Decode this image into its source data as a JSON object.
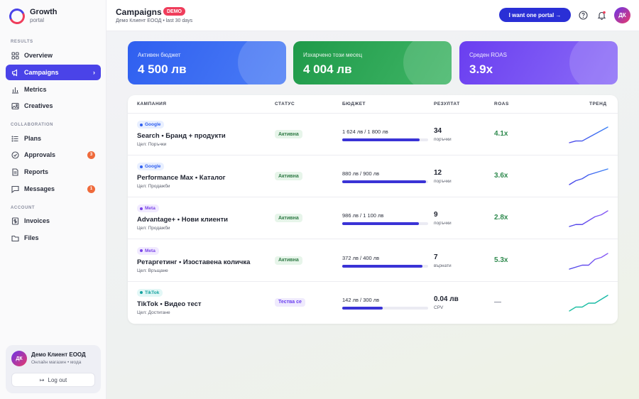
{
  "brand": {
    "title": "Growth",
    "subtitle": "portal"
  },
  "sidebar": {
    "sections": [
      {
        "label": "RESULTS"
      },
      {
        "label": "COLLABORATION"
      },
      {
        "label": "ACCOUNT"
      }
    ],
    "items": [
      {
        "label": "Overview",
        "icon": "grid-icon"
      },
      {
        "label": "Campaigns",
        "icon": "megaphone-icon",
        "active": true
      },
      {
        "label": "Metrics",
        "icon": "bar-chart-icon"
      },
      {
        "label": "Creatives",
        "icon": "image-icon"
      },
      {
        "label": "Plans",
        "icon": "list-icon"
      },
      {
        "label": "Approvals",
        "icon": "check-circle-icon",
        "badge": "3"
      },
      {
        "label": "Reports",
        "icon": "document-icon"
      },
      {
        "label": "Messages",
        "icon": "chat-icon",
        "badge": "1"
      },
      {
        "label": "Invoices",
        "icon": "dollar-icon"
      },
      {
        "label": "Files",
        "icon": "folder-icon"
      }
    ],
    "user": {
      "initials": "ДК",
      "name": "Демо Клиент ЕООД",
      "subtitle": "Онлайн магазин • мода",
      "logout_label": "Log out"
    }
  },
  "header": {
    "title": "Campaigns",
    "badge": "DEMO",
    "subtitle": "Демо Клиент ЕООД • last 30 days",
    "cta_label": "I want one  portal →",
    "avatar_initials": "ДК"
  },
  "kpis": [
    {
      "label": "Активен бюджет",
      "value": "4 500 лв",
      "color_from": "#2f5ff0",
      "color_to": "#4a7cf5"
    },
    {
      "label": "Изхарчено този месец",
      "value": "4 004 лв",
      "color_from": "#1f9a4a",
      "color_to": "#3fb565"
    },
    {
      "label": "Среден ROAS",
      "value": "3.9x",
      "color_from": "#6a3ef0",
      "color_to": "#8b6cf7"
    }
  ],
  "table": {
    "headers": {
      "campaign": "КАМПАНИЯ",
      "status": "СТАТУС",
      "budget": "БЮДЖЕТ",
      "result": "РЕЗУЛТАТ",
      "roas": "ROAS",
      "trend": "ТРЕНД"
    },
    "rows": [
      {
        "platform": "Google",
        "name": "Search • Бранд + продукти",
        "goal": "Цел: Поръчки",
        "status": "Активна",
        "budget_text": "1 624 лв / 1 800 лв",
        "budget_progress": 0.902,
        "result_value": "34",
        "result_unit": "поръчки",
        "roas": "4.1x",
        "trend": [
          2,
          3,
          3,
          5,
          7,
          9,
          11
        ]
      },
      {
        "platform": "Google",
        "name": "Performance Max • Каталог",
        "goal": "Цел: Продажби",
        "status": "Активна",
        "budget_text": "880 лв / 900 лв",
        "budget_progress": 0.978,
        "result_value": "12",
        "result_unit": "поръчки",
        "roas": "3.6x",
        "trend": [
          1,
          3,
          4,
          6,
          7,
          8,
          9
        ]
      },
      {
        "platform": "Meta",
        "name": "Advantage+ • Нови клиенти",
        "goal": "Цел: Продажби",
        "status": "Активна",
        "budget_text": "986 лв / 1 100 лв",
        "budget_progress": 0.896,
        "result_value": "9",
        "result_unit": "поръчки",
        "roas": "2.8x",
        "trend": [
          1,
          2,
          2,
          4,
          6,
          7,
          9
        ]
      },
      {
        "platform": "Meta",
        "name": "Ретаргетинг • Изоставена количка",
        "goal": "Цел: Връщане",
        "status": "Активна",
        "budget_text": "372 лв / 400 лв",
        "budget_progress": 0.93,
        "result_value": "7",
        "result_unit": "върнати",
        "roas": "5.3x",
        "trend": [
          1,
          2,
          3,
          3,
          6,
          7,
          9
        ]
      },
      {
        "platform": "TikTok",
        "name": "TikTok • Видео тест",
        "goal": "Цел: Достигане",
        "status": "Тества се",
        "budget_text": "142 лв / 300 лв",
        "budget_progress": 0.473,
        "result_value": "0.04 лв",
        "result_unit": "CPV",
        "roas": "—",
        "trend": [
          1,
          3,
          3,
          5,
          5,
          7,
          9
        ]
      }
    ]
  },
  "colors": {
    "accent": "#4a43e8",
    "google_bg": "#e8efff",
    "google_fg": "#2f5ff0",
    "meta_bg": "#f1eaff",
    "meta_fg": "#7a45e8",
    "tiktok_bg": "#e2f7f6",
    "tiktok_fg": "#16a3a0",
    "active_bg": "#e7f5ea",
    "active_fg": "#2f7a45",
    "testing_bg": "#efeafd",
    "testing_fg": "#6a3ef0"
  }
}
